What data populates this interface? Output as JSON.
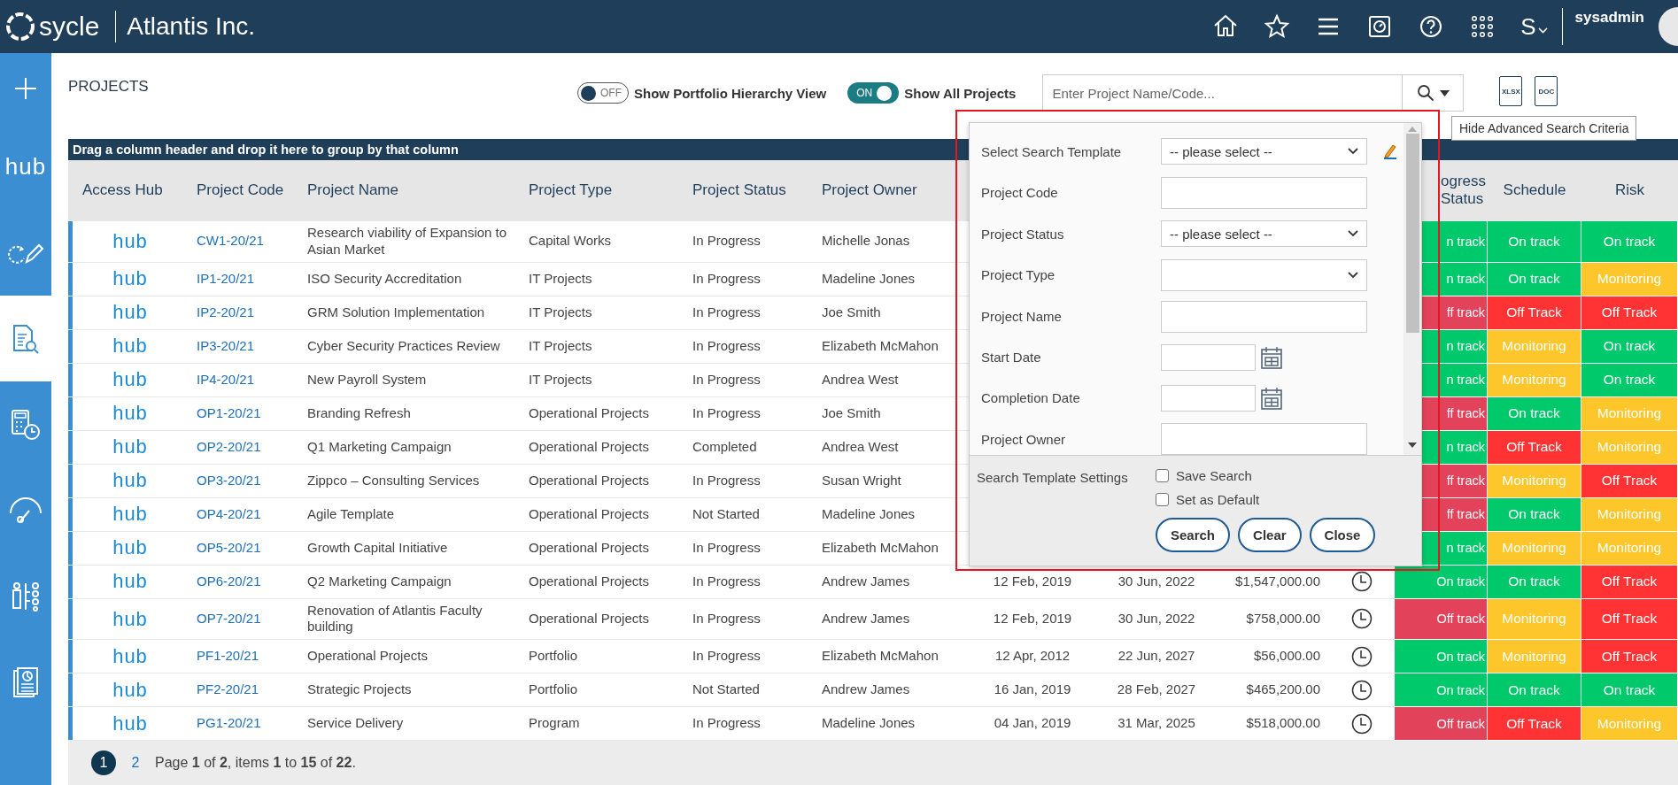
{
  "header": {
    "logo": "sycle",
    "company": "Atlantis Inc.",
    "user_initial": "S",
    "username": "sysadmin"
  },
  "sidebar": {
    "items": [
      {
        "kind": "plus",
        "selected": false
      },
      {
        "kind": "hub",
        "label": "hub",
        "selected": false
      },
      {
        "kind": "edit-cycle",
        "selected": false
      },
      {
        "kind": "doc-search",
        "selected": true
      },
      {
        "kind": "calculator",
        "selected": false
      },
      {
        "kind": "gauge",
        "selected": false
      },
      {
        "kind": "sliders",
        "selected": false
      },
      {
        "kind": "report",
        "selected": false
      }
    ]
  },
  "toolbar": {
    "title": "PROJECTS",
    "toggles": [
      {
        "state": "OFF",
        "label": "Show Portfolio Hierarchy View",
        "on": false
      },
      {
        "state": "ON",
        "label": "Show All Projects",
        "on": true
      }
    ],
    "search": {
      "placeholder": "Enter Project Name/Code..."
    },
    "exports": [
      "XLSX",
      "DOC"
    ],
    "tooltip": "Hide Advanced Search Criteria"
  },
  "table": {
    "group_hint": "Drag a column header and drop it here to group by that column",
    "columns": [
      "Access Hub",
      "Project Code",
      "Project Name",
      "Project Type",
      "Project Status",
      "Project Owner"
    ],
    "status_columns": [
      "ogress Status",
      "Schedule",
      "Risk"
    ],
    "rows": [
      {
        "hub": "hub",
        "code": "CW1-20/21",
        "name": "Research viability of Expansion to Asian Market",
        "type": "Capital Works",
        "status": "In Progress",
        "owner": "Michelle Jonas",
        "progress": {
          "text": "n track",
          "color": "#00c96b"
        },
        "schedule": {
          "text": "On track",
          "color": "#00c96b"
        },
        "risk": {
          "text": "On track",
          "color": "#00c96b"
        }
      },
      {
        "hub": "hub",
        "code": "IP1-20/21",
        "name": "ISO Security Accreditation",
        "type": "IT Projects",
        "status": "In Progress",
        "owner": "Madeline Jones",
        "progress": {
          "text": "n track",
          "color": "#00c96b"
        },
        "schedule": {
          "text": "On track",
          "color": "#00c96b"
        },
        "risk": {
          "text": "Monitoring",
          "color": "#fdc72c"
        }
      },
      {
        "hub": "hub",
        "code": "IP2-20/21",
        "name": "GRM Solution Implementation",
        "type": "IT Projects",
        "status": "In Progress",
        "owner": "Joe Smith",
        "progress": {
          "text": "ff track",
          "color": "#e2425a"
        },
        "schedule": {
          "text": "Off Track",
          "color": "#ff3333"
        },
        "risk": {
          "text": "Off Track",
          "color": "#ff3333"
        }
      },
      {
        "hub": "hub",
        "code": "IP3-20/21",
        "name": "Cyber Security Practices Review",
        "type": "IT Projects",
        "status": "In Progress",
        "owner": "Elizabeth McMahon",
        "progress": {
          "text": "n track",
          "color": "#00c96b"
        },
        "schedule": {
          "text": "Monitoring",
          "color": "#fdc72c"
        },
        "risk": {
          "text": "On track",
          "color": "#00c96b"
        }
      },
      {
        "hub": "hub",
        "code": "IP4-20/21",
        "name": "New Payroll System",
        "type": "IT Projects",
        "status": "In Progress",
        "owner": "Andrea West",
        "progress": {
          "text": "n track",
          "color": "#00c96b"
        },
        "schedule": {
          "text": "Monitoring",
          "color": "#fdc72c"
        },
        "risk": {
          "text": "On track",
          "color": "#00c96b"
        }
      },
      {
        "hub": "hub",
        "code": "OP1-20/21",
        "name": "Branding Refresh",
        "type": "Operational Projects",
        "status": "In Progress",
        "owner": "Joe Smith",
        "progress": {
          "text": "ff track",
          "color": "#e2425a"
        },
        "schedule": {
          "text": "On track",
          "color": "#00c96b"
        },
        "risk": {
          "text": "Monitoring",
          "color": "#fdc72c"
        }
      },
      {
        "hub": "hub",
        "code": "OP2-20/21",
        "name": "Q1 Marketing Campaign",
        "type": "Operational Projects",
        "status": "Completed",
        "owner": "Andrea West",
        "progress": {
          "text": "n track",
          "color": "#00c96b"
        },
        "schedule": {
          "text": "Off Track",
          "color": "#ff3333"
        },
        "risk": {
          "text": "Monitoring",
          "color": "#fdc72c"
        }
      },
      {
        "hub": "hub",
        "code": "OP3-20/21",
        "name": "Zippco – Consulting Services",
        "type": "Operational Projects",
        "status": "In Progress",
        "owner": "Susan Wright",
        "progress": {
          "text": "ff track",
          "color": "#e2425a"
        },
        "schedule": {
          "text": "Monitoring",
          "color": "#fdc72c"
        },
        "risk": {
          "text": "Off Track",
          "color": "#ff3333"
        }
      },
      {
        "hub": "hub",
        "code": "OP4-20/21",
        "name": "Agile Template",
        "type": "Operational Projects",
        "status": "Not Started",
        "owner": "Madeline Jones",
        "progress": {
          "text": "ff track",
          "color": "#e2425a"
        },
        "schedule": {
          "text": "On track",
          "color": "#00c96b"
        },
        "risk": {
          "text": "Monitoring",
          "color": "#fdc72c"
        }
      },
      {
        "hub": "hub",
        "code": "OP5-20/21",
        "name": "Growth Capital Initiative",
        "type": "Operational Projects",
        "status": "In Progress",
        "owner": "Elizabeth McMahon",
        "progress": {
          "text": "n track",
          "color": "#00c96b"
        },
        "schedule": {
          "text": "Monitoring",
          "color": "#fdc72c"
        },
        "risk": {
          "text": "Monitoring",
          "color": "#fdc72c"
        }
      },
      {
        "hub": "hub",
        "code": "OP6-20/21",
        "name": "Q2 Marketing Campaign",
        "type": "Operational Projects",
        "status": "In Progress",
        "owner": "Andrew James",
        "start": "12 Feb, 2019",
        "completion": "30 Jun, 2022",
        "budget": "$1,547,000.00",
        "progress": {
          "text": "On track",
          "color": "#00c96b"
        },
        "schedule": {
          "text": "On track",
          "color": "#00c96b"
        },
        "risk": {
          "text": "Off Track",
          "color": "#ff3333"
        }
      },
      {
        "hub": "hub",
        "code": "OP7-20/21",
        "name": "Renovation of Atlantis Faculty building",
        "type": "Operational Projects",
        "status": "In Progress",
        "owner": "Andrew James",
        "start": "12 Feb, 2019",
        "completion": "30 Jun, 2022",
        "budget": "$758,000.00",
        "progress": {
          "text": "Off track",
          "color": "#e2425a"
        },
        "schedule": {
          "text": "Monitoring",
          "color": "#fdc72c"
        },
        "risk": {
          "text": "Off Track",
          "color": "#ff3333"
        }
      },
      {
        "hub": "hub",
        "code": "PF1-20/21",
        "name": "Operational Projects",
        "type": "Portfolio",
        "status": "In Progress",
        "owner": "Elizabeth McMahon",
        "start": "12 Apr, 2012",
        "completion": "22 Jun, 2027",
        "budget": "$56,000.00",
        "progress": {
          "text": "On track",
          "color": "#00c96b"
        },
        "schedule": {
          "text": "Monitoring",
          "color": "#fdc72c"
        },
        "risk": {
          "text": "Off Track",
          "color": "#ff3333"
        }
      },
      {
        "hub": "hub",
        "code": "PF2-20/21",
        "name": "Strategic Projects",
        "type": "Portfolio",
        "status": "Not Started",
        "owner": "Andrew James",
        "start": "16 Jan, 2019",
        "completion": "28 Feb, 2027",
        "budget": "$465,200.00",
        "progress": {
          "text": "On track",
          "color": "#00c96b"
        },
        "schedule": {
          "text": "On track",
          "color": "#00c96b"
        },
        "risk": {
          "text": "On track",
          "color": "#00c96b"
        }
      },
      {
        "hub": "hub",
        "code": "PG1-20/21",
        "name": "Service Delivery",
        "type": "Program",
        "status": "In Progress",
        "owner": "Madeline Jones",
        "start": "04 Jan, 2019",
        "completion": "31 Mar, 2025",
        "budget": "$518,000.00",
        "progress": {
          "text": "Off track",
          "color": "#e2425a"
        },
        "schedule": {
          "text": "Off Track",
          "color": "#ff3333"
        },
        "risk": {
          "text": "Monitoring",
          "color": "#fdc72c"
        }
      }
    ]
  },
  "pager": {
    "pages": [
      {
        "label": "1",
        "selected": true
      },
      {
        "label": "2",
        "selected": false
      }
    ],
    "summary": "Page **1** of **2**, items **1** to **15** of **22**."
  },
  "search_panel": {
    "fields": [
      {
        "kind": "select",
        "label": "Select Search Template",
        "value": "-- please select --",
        "edit": true
      },
      {
        "kind": "input",
        "label": "Project Code",
        "edit": false
      },
      {
        "kind": "select",
        "label": "Project Status",
        "value": "-- please select --",
        "edit": false
      },
      {
        "kind": "select",
        "label": "Project Type",
        "edit": false
      },
      {
        "kind": "input",
        "label": "Project Name",
        "edit": false
      },
      {
        "kind": "date",
        "label": "Start Date",
        "edit": false
      },
      {
        "kind": "date",
        "label": "Completion Date",
        "edit": false
      },
      {
        "kind": "input",
        "label": "Project Owner",
        "edit": false
      }
    ],
    "settings_label": "Search Template Settings",
    "options": [
      {
        "label": "Save Search",
        "checked": false
      },
      {
        "label": "Set as Default",
        "checked": false
      }
    ],
    "buttons": [
      "Search",
      "Clear",
      "Close"
    ]
  }
}
